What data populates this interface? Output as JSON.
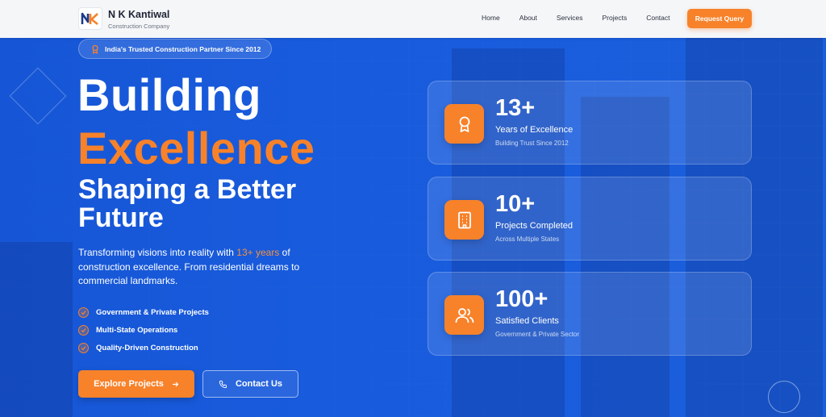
{
  "nav": {
    "brand_name": "N K Kantiwal",
    "brand_sub": "Construction Company",
    "logo_text": "NK",
    "links": [
      "Home",
      "About",
      "Services",
      "Projects",
      "Contact"
    ],
    "cta": "Request Query"
  },
  "hero": {
    "badge": "India's Trusted Construction Partner Since 2012",
    "title_line1": "Building",
    "title_line2": "Excellence",
    "subtitle": "Shaping a Better Future",
    "desc_before": "Transforming visions into reality with ",
    "desc_highlight": "13+ years",
    "desc_after": " of construction excellence. From residential dreams to commercial landmarks.",
    "features": [
      "Government & Private Projects",
      "Multi-State Operations",
      "Quality-Driven Construction"
    ],
    "btn_explore": "Explore Projects",
    "btn_contact": "Contact Us"
  },
  "stats": [
    {
      "value": "13+",
      "label": "Years of Excellence",
      "sub": "Building Trust Since 2012",
      "icon": "award-icon"
    },
    {
      "value": "10+",
      "label": "Projects Completed",
      "sub": "Across Multiple States",
      "icon": "building-icon"
    },
    {
      "value": "100+",
      "label": "Satisfied Clients",
      "sub": "Government & Private Sector",
      "icon": "users-icon"
    }
  ],
  "colors": {
    "primary": "#1b5bd6",
    "accent": "#f7822a",
    "navbar": "#f5f6f8"
  }
}
